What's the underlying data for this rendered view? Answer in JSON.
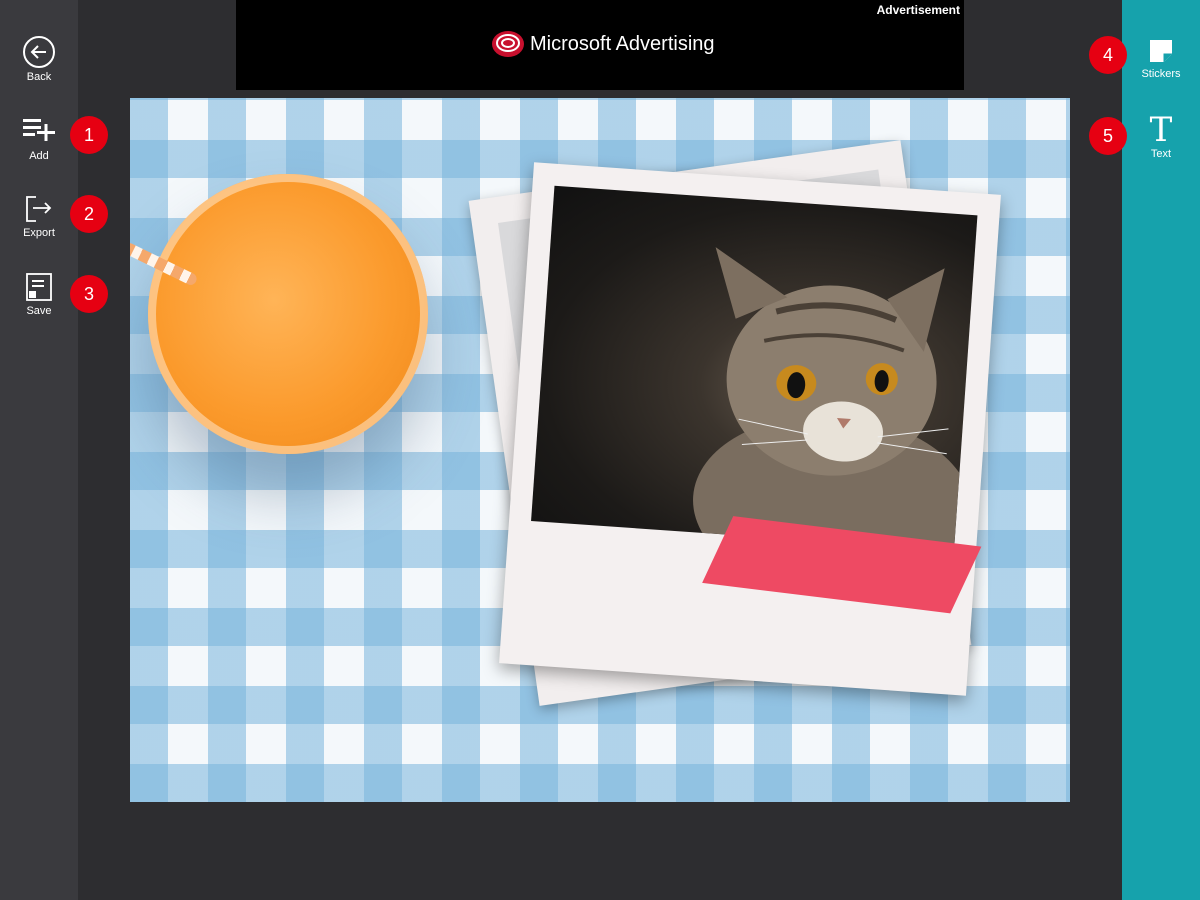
{
  "left_toolbar": {
    "items": [
      {
        "label": "Back",
        "icon": "back-arrow-icon"
      },
      {
        "label": "Add",
        "icon": "add-icon",
        "badge": "1"
      },
      {
        "label": "Export",
        "icon": "export-icon",
        "badge": "2"
      },
      {
        "label": "Save",
        "icon": "save-icon",
        "badge": "3"
      }
    ]
  },
  "right_toolbar": {
    "items": [
      {
        "label": "Stickers",
        "icon": "stickers-icon",
        "badge": "4"
      },
      {
        "label": "Text",
        "icon": "text-icon",
        "badge": "5"
      }
    ]
  },
  "ad": {
    "label": "Advertisement",
    "brand": "Microsoft Advertising"
  },
  "colors": {
    "left_bar": "#3a3a3e",
    "right_bar": "#16a2ac",
    "badge": "#e60012",
    "background": "#2d2d30"
  }
}
